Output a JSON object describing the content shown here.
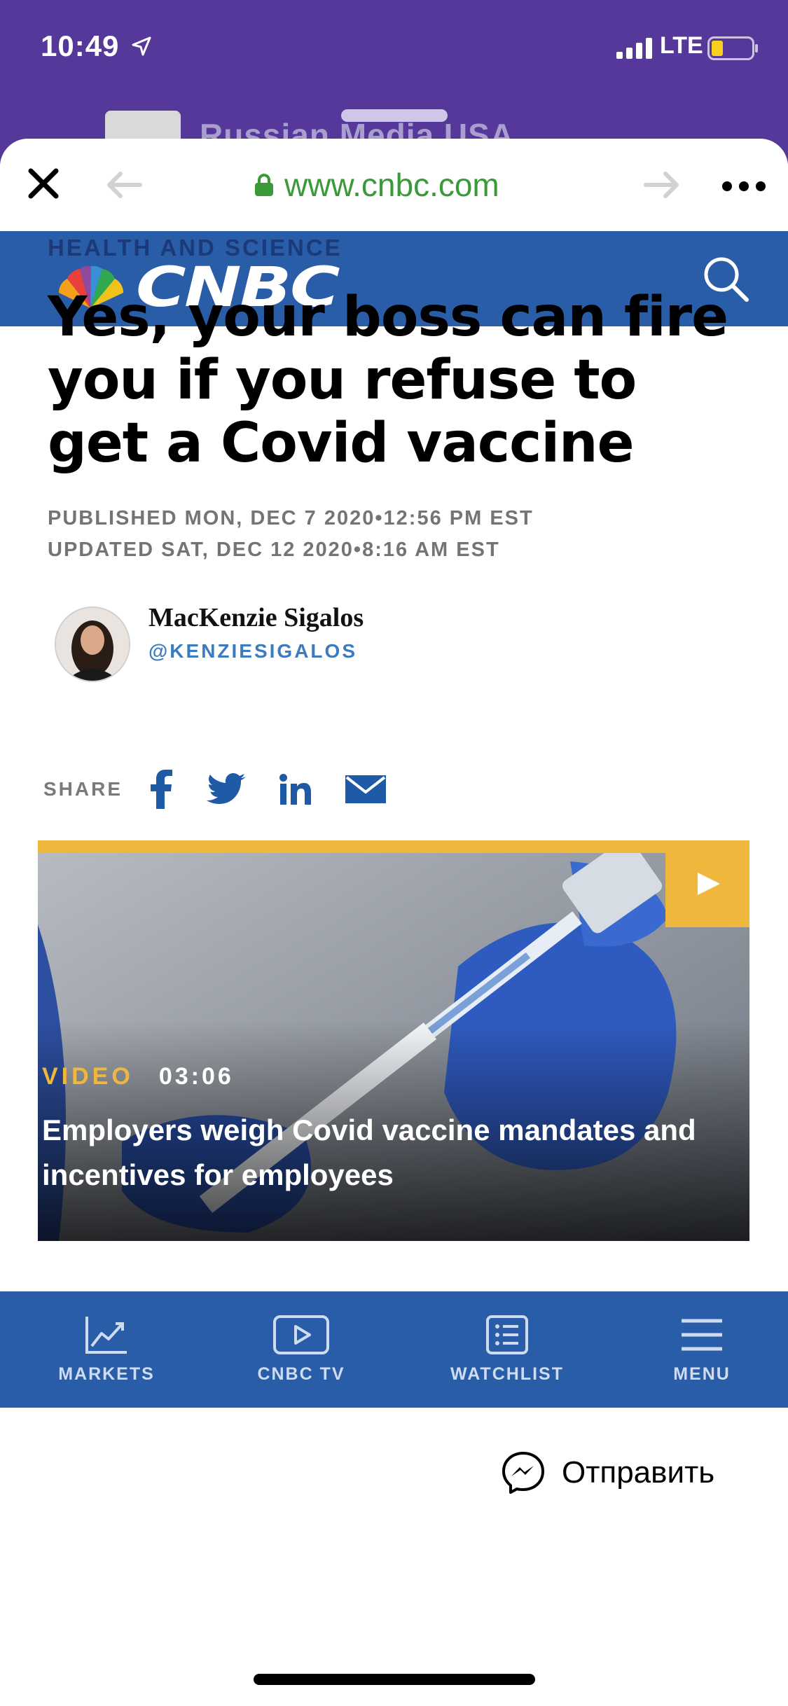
{
  "status_bar": {
    "time": "10:49",
    "network": "LTE"
  },
  "background_app": {
    "title": "Russian Media USA"
  },
  "browser": {
    "url": "www.cnbc.com"
  },
  "site": {
    "name": "CNBC",
    "brand_color": "#2a5da8"
  },
  "article": {
    "category": "HEALTH AND SCIENCE",
    "headline": "Yes, your boss can fire you if you refuse to get a Covid vaccine",
    "published": "PUBLISHED MON, DEC 7 2020•12:56 PM EST",
    "updated": "UPDATED SAT, DEC 12 2020•8:16 AM EST",
    "author_name": "MacKenzie Sigalos",
    "author_handle": "@KENZIESIGALOS",
    "share_label": "SHARE"
  },
  "video": {
    "tag": "VIDEO",
    "duration": "03:06",
    "title": "Employers weigh Covid vaccine mandates and incentives for employees",
    "accent_color": "#f0b73d"
  },
  "bottom_nav": {
    "markets": "MARKETS",
    "cnbc_tv": "CNBC TV",
    "watchlist": "WATCHLIST",
    "menu": "MENU"
  },
  "share_sheet": {
    "send_label": "Отправить"
  }
}
